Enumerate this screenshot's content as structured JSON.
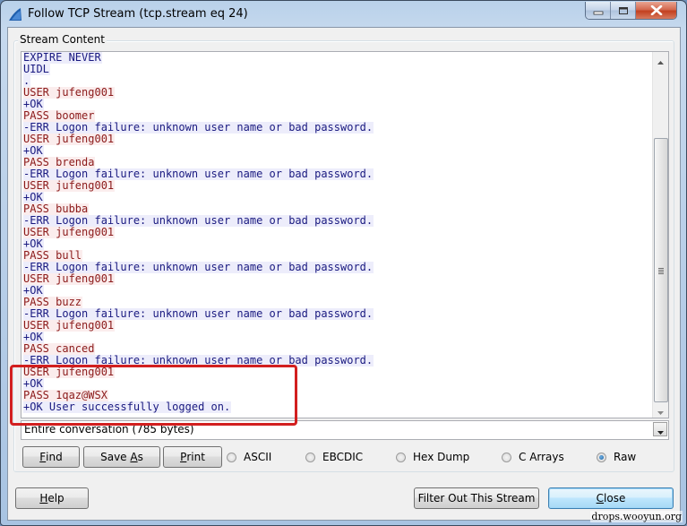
{
  "window": {
    "title": "Follow TCP Stream (tcp.stream eq 24)",
    "app_icon": "wireshark-fin-icon",
    "controls": {
      "minimize": "minimize-icon",
      "maximize": "maximize-icon",
      "close": "close-icon"
    }
  },
  "stream_content": {
    "group_label": "Stream Content",
    "colors": {
      "client_text": "#8b1a1a",
      "client_bg": "#fbeded",
      "server_text": "#1a1a80",
      "server_bg": "#ededfb"
    },
    "lines": [
      {
        "dir": "server",
        "text": "EXPIRE NEVER"
      },
      {
        "dir": "server",
        "text": "UIDL"
      },
      {
        "dir": "server",
        "text": "."
      },
      {
        "dir": "client",
        "text": "USER jufeng001"
      },
      {
        "dir": "server",
        "text": "+OK"
      },
      {
        "dir": "client",
        "text": "PASS boomer"
      },
      {
        "dir": "server",
        "text": "-ERR Logon failure: unknown user name or bad password."
      },
      {
        "dir": "client",
        "text": "USER jufeng001"
      },
      {
        "dir": "server",
        "text": "+OK"
      },
      {
        "dir": "client",
        "text": "PASS brenda"
      },
      {
        "dir": "server",
        "text": "-ERR Logon failure: unknown user name or bad password."
      },
      {
        "dir": "client",
        "text": "USER jufeng001"
      },
      {
        "dir": "server",
        "text": "+OK"
      },
      {
        "dir": "client",
        "text": "PASS bubba"
      },
      {
        "dir": "server",
        "text": "-ERR Logon failure: unknown user name or bad password."
      },
      {
        "dir": "client",
        "text": "USER jufeng001"
      },
      {
        "dir": "server",
        "text": "+OK"
      },
      {
        "dir": "client",
        "text": "PASS bull"
      },
      {
        "dir": "server",
        "text": "-ERR Logon failure: unknown user name or bad password."
      },
      {
        "dir": "client",
        "text": "USER jufeng001"
      },
      {
        "dir": "server",
        "text": "+OK"
      },
      {
        "dir": "client",
        "text": "PASS buzz"
      },
      {
        "dir": "server",
        "text": "-ERR Logon failure: unknown user name or bad password."
      },
      {
        "dir": "client",
        "text": "USER jufeng001"
      },
      {
        "dir": "server",
        "text": "+OK"
      },
      {
        "dir": "client",
        "text": "PASS canced"
      },
      {
        "dir": "server",
        "text": "-ERR Logon failure: unknown user name or bad password."
      },
      {
        "dir": "client",
        "text": "USER jufeng001"
      },
      {
        "dir": "server",
        "text": "+OK"
      },
      {
        "dir": "client",
        "text": "PASS 1qaz@WSX"
      },
      {
        "dir": "server",
        "text": "+OK User successfully logged on."
      }
    ],
    "scroll_position": 1.0,
    "annotation": {
      "color": "#d21f1f",
      "label": "highlight-successful-login"
    }
  },
  "conversation_select": {
    "selected": "Entire conversation (785 bytes)"
  },
  "actions": {
    "find": {
      "mnemonic": "F",
      "rest": "ind"
    },
    "save_as": {
      "pre": "Save ",
      "mnemonic": "A",
      "rest": "s"
    },
    "print": {
      "mnemonic": "P",
      "rest": "rint"
    }
  },
  "format_options": [
    {
      "label": "ASCII",
      "checked": false
    },
    {
      "label": "EBCDIC",
      "checked": false
    },
    {
      "label": "Hex Dump",
      "checked": false
    },
    {
      "label": "C Arrays",
      "checked": false
    },
    {
      "label": "Raw",
      "checked": true
    }
  ],
  "footer": {
    "help": {
      "mnemonic": "H",
      "rest": "elp"
    },
    "filter_out": "Filter Out This Stream",
    "close": {
      "mnemonic": "C",
      "rest": "lose"
    }
  },
  "watermark": "drops.wooyun.org"
}
